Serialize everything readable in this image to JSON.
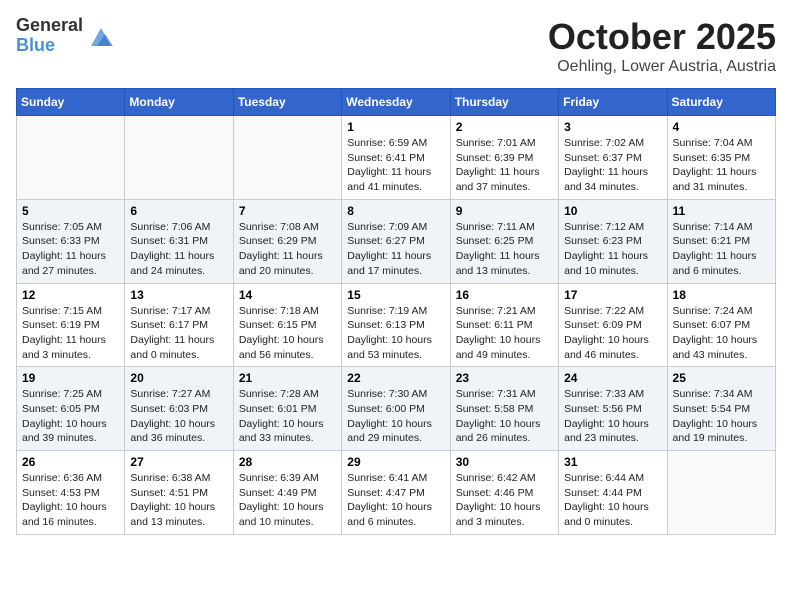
{
  "header": {
    "logo_general": "General",
    "logo_blue": "Blue",
    "month_title": "October 2025",
    "location": "Oehling, Lower Austria, Austria"
  },
  "days_of_week": [
    "Sunday",
    "Monday",
    "Tuesday",
    "Wednesday",
    "Thursday",
    "Friday",
    "Saturday"
  ],
  "weeks": [
    [
      {
        "day": "",
        "info": ""
      },
      {
        "day": "",
        "info": ""
      },
      {
        "day": "",
        "info": ""
      },
      {
        "day": "1",
        "info": "Sunrise: 6:59 AM\nSunset: 6:41 PM\nDaylight: 11 hours\nand 41 minutes."
      },
      {
        "day": "2",
        "info": "Sunrise: 7:01 AM\nSunset: 6:39 PM\nDaylight: 11 hours\nand 37 minutes."
      },
      {
        "day": "3",
        "info": "Sunrise: 7:02 AM\nSunset: 6:37 PM\nDaylight: 11 hours\nand 34 minutes."
      },
      {
        "day": "4",
        "info": "Sunrise: 7:04 AM\nSunset: 6:35 PM\nDaylight: 11 hours\nand 31 minutes."
      }
    ],
    [
      {
        "day": "5",
        "info": "Sunrise: 7:05 AM\nSunset: 6:33 PM\nDaylight: 11 hours\nand 27 minutes."
      },
      {
        "day": "6",
        "info": "Sunrise: 7:06 AM\nSunset: 6:31 PM\nDaylight: 11 hours\nand 24 minutes."
      },
      {
        "day": "7",
        "info": "Sunrise: 7:08 AM\nSunset: 6:29 PM\nDaylight: 11 hours\nand 20 minutes."
      },
      {
        "day": "8",
        "info": "Sunrise: 7:09 AM\nSunset: 6:27 PM\nDaylight: 11 hours\nand 17 minutes."
      },
      {
        "day": "9",
        "info": "Sunrise: 7:11 AM\nSunset: 6:25 PM\nDaylight: 11 hours\nand 13 minutes."
      },
      {
        "day": "10",
        "info": "Sunrise: 7:12 AM\nSunset: 6:23 PM\nDaylight: 11 hours\nand 10 minutes."
      },
      {
        "day": "11",
        "info": "Sunrise: 7:14 AM\nSunset: 6:21 PM\nDaylight: 11 hours\nand 6 minutes."
      }
    ],
    [
      {
        "day": "12",
        "info": "Sunrise: 7:15 AM\nSunset: 6:19 PM\nDaylight: 11 hours\nand 3 minutes."
      },
      {
        "day": "13",
        "info": "Sunrise: 7:17 AM\nSunset: 6:17 PM\nDaylight: 11 hours\nand 0 minutes."
      },
      {
        "day": "14",
        "info": "Sunrise: 7:18 AM\nSunset: 6:15 PM\nDaylight: 10 hours\nand 56 minutes."
      },
      {
        "day": "15",
        "info": "Sunrise: 7:19 AM\nSunset: 6:13 PM\nDaylight: 10 hours\nand 53 minutes."
      },
      {
        "day": "16",
        "info": "Sunrise: 7:21 AM\nSunset: 6:11 PM\nDaylight: 10 hours\nand 49 minutes."
      },
      {
        "day": "17",
        "info": "Sunrise: 7:22 AM\nSunset: 6:09 PM\nDaylight: 10 hours\nand 46 minutes."
      },
      {
        "day": "18",
        "info": "Sunrise: 7:24 AM\nSunset: 6:07 PM\nDaylight: 10 hours\nand 43 minutes."
      }
    ],
    [
      {
        "day": "19",
        "info": "Sunrise: 7:25 AM\nSunset: 6:05 PM\nDaylight: 10 hours\nand 39 minutes."
      },
      {
        "day": "20",
        "info": "Sunrise: 7:27 AM\nSunset: 6:03 PM\nDaylight: 10 hours\nand 36 minutes."
      },
      {
        "day": "21",
        "info": "Sunrise: 7:28 AM\nSunset: 6:01 PM\nDaylight: 10 hours\nand 33 minutes."
      },
      {
        "day": "22",
        "info": "Sunrise: 7:30 AM\nSunset: 6:00 PM\nDaylight: 10 hours\nand 29 minutes."
      },
      {
        "day": "23",
        "info": "Sunrise: 7:31 AM\nSunset: 5:58 PM\nDaylight: 10 hours\nand 26 minutes."
      },
      {
        "day": "24",
        "info": "Sunrise: 7:33 AM\nSunset: 5:56 PM\nDaylight: 10 hours\nand 23 minutes."
      },
      {
        "day": "25",
        "info": "Sunrise: 7:34 AM\nSunset: 5:54 PM\nDaylight: 10 hours\nand 19 minutes."
      }
    ],
    [
      {
        "day": "26",
        "info": "Sunrise: 6:36 AM\nSunset: 4:53 PM\nDaylight: 10 hours\nand 16 minutes."
      },
      {
        "day": "27",
        "info": "Sunrise: 6:38 AM\nSunset: 4:51 PM\nDaylight: 10 hours\nand 13 minutes."
      },
      {
        "day": "28",
        "info": "Sunrise: 6:39 AM\nSunset: 4:49 PM\nDaylight: 10 hours\nand 10 minutes."
      },
      {
        "day": "29",
        "info": "Sunrise: 6:41 AM\nSunset: 4:47 PM\nDaylight: 10 hours\nand 6 minutes."
      },
      {
        "day": "30",
        "info": "Sunrise: 6:42 AM\nSunset: 4:46 PM\nDaylight: 10 hours\nand 3 minutes."
      },
      {
        "day": "31",
        "info": "Sunrise: 6:44 AM\nSunset: 4:44 PM\nDaylight: 10 hours\nand 0 minutes."
      },
      {
        "day": "",
        "info": ""
      }
    ]
  ]
}
